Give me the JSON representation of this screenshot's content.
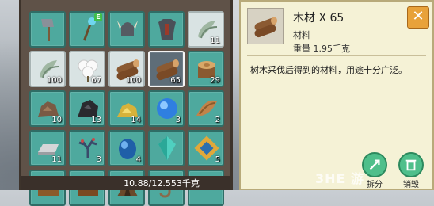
{
  "inventory": {
    "slots": [
      {
        "icon": "stone-axe-icon",
        "count": ""
      },
      {
        "icon": "crystal-staff-icon",
        "count": "",
        "badge": "E"
      },
      {
        "icon": "horned-helmet-icon",
        "count": ""
      },
      {
        "icon": "chest-armor-icon",
        "count": ""
      },
      {
        "icon": "herb-bundle-icon",
        "count": "11"
      },
      {
        "icon": "herb-bundle-icon",
        "count": "100"
      },
      {
        "icon": "cotton-icon",
        "count": "67"
      },
      {
        "icon": "wood-log-icon",
        "count": "100"
      },
      {
        "icon": "wood-log-icon",
        "count": "65"
      },
      {
        "icon": "tree-stump-icon",
        "count": "29"
      },
      {
        "icon": "rock-ore-icon",
        "count": "10"
      },
      {
        "icon": "coal-ore-icon",
        "count": "13"
      },
      {
        "icon": "gold-ore-icon",
        "count": "14"
      },
      {
        "icon": "blue-crystal-icon",
        "count": "3"
      },
      {
        "icon": "bark-icon",
        "count": "2"
      },
      {
        "icon": "iron-ingot-icon",
        "count": "11"
      },
      {
        "icon": "coral-icon",
        "count": "3"
      },
      {
        "icon": "blue-gem-icon",
        "count": "4"
      },
      {
        "icon": "diamond-icon",
        "count": ""
      },
      {
        "icon": "frame-item-icon",
        "count": "5"
      },
      {
        "icon": "chest-icon",
        "count": ""
      },
      {
        "icon": "chest-icon",
        "count": ""
      },
      {
        "icon": "tent-icon",
        "count": ""
      },
      {
        "icon": "hook-icon",
        "count": ""
      },
      {
        "icon": "blank-icon",
        "count": ""
      }
    ],
    "weight_text": "10.88/12.553千克"
  },
  "detail": {
    "icon": "wood-log-icon",
    "name": "木材 X 65",
    "type": "材料",
    "weight": "重量 1.95千克",
    "description": "树木采伐后得到的材料，用途十分广泛。",
    "close_label": "✕",
    "split_label": "拆分",
    "destroy_label": "销毁"
  },
  "watermark": "3HE 游"
}
